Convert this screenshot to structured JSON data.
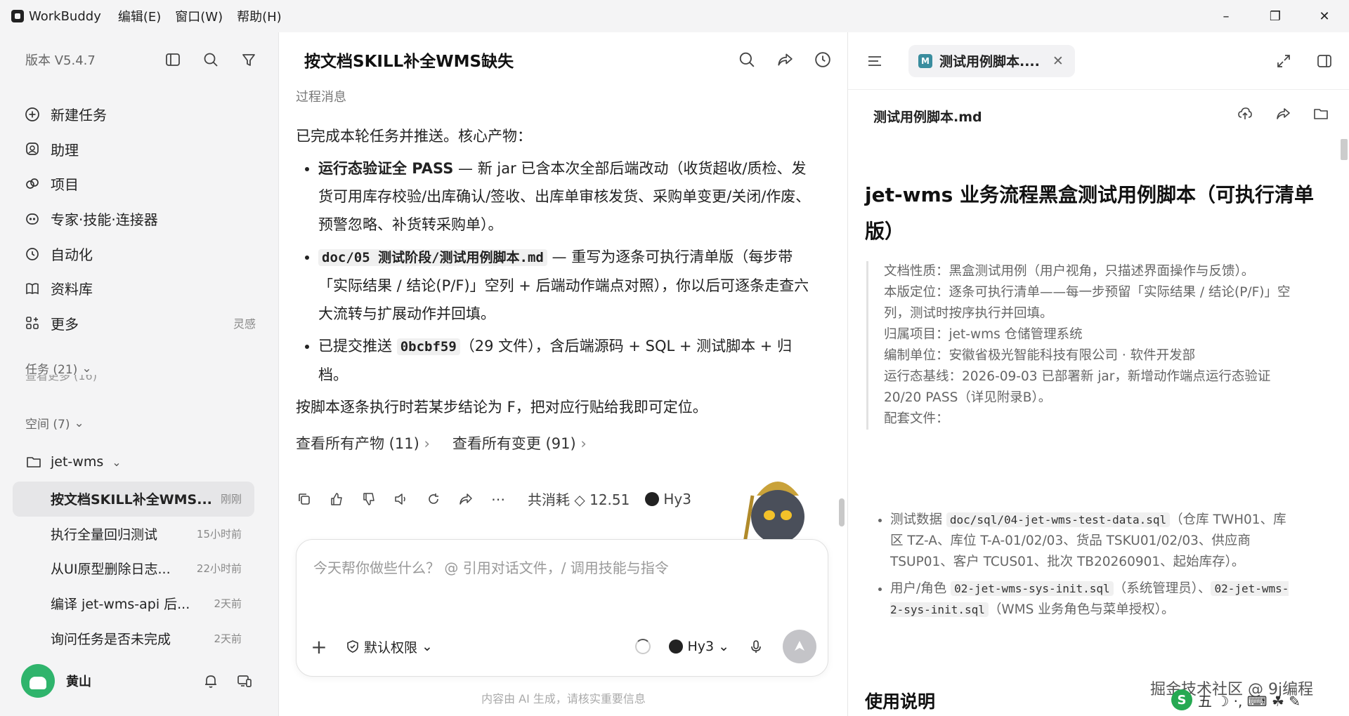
{
  "app": {
    "name": "WorkBuddy",
    "menu": [
      "编辑(E)",
      "窗口(W)",
      "帮助(H)"
    ]
  },
  "window": {
    "minimize": "–",
    "restore": "❐",
    "close": "✕"
  },
  "sidebar": {
    "version": "版本 V5.4.7",
    "nav": [
      {
        "label": "新建任务",
        "icon": "plus-circle-icon"
      },
      {
        "label": "助理",
        "icon": "assistant-icon"
      },
      {
        "label": "项目",
        "icon": "project-icon"
      },
      {
        "label": "专家·技能·连接器",
        "icon": "expert-icon"
      },
      {
        "label": "自动化",
        "icon": "clock-icon"
      },
      {
        "label": "资料库",
        "icon": "book-icon"
      },
      {
        "label": "更多",
        "icon": "grid-icon",
        "extra": "灵感"
      }
    ],
    "tasks_label": "任务 (21)",
    "tasks_peek": "查看更多 (16)",
    "space_label": "空间 (7)",
    "folder": "jet-wms",
    "tasks": [
      {
        "title": "按文档SKILL补全WMS...",
        "time": "刚刚",
        "active": true
      },
      {
        "title": "执行全量回归测试",
        "time": "15小时前"
      },
      {
        "title": "从UI原型删除日志...",
        "time": "22小时前"
      },
      {
        "title": "编译 jet-wms-api 后...",
        "time": "2天前"
      },
      {
        "title": "询问任务是否未完成",
        "time": "2天前"
      }
    ],
    "user": "黄山"
  },
  "main": {
    "title": "按文档SKILL补全WMS缺失",
    "process_label": "过程消息",
    "intro": "已完成本轮任务并推送。核心产物：",
    "bullet1": {
      "strong": "运行态验证全 PASS",
      "text": " — 新 jar 已含本次全部后端改动（收货超收/质检、发货可用库存校验/出库确认/签收、出库单审核发货、采购单变更/关闭/作废、预警忽略、补货转采购单）。"
    },
    "bullet2": {
      "code": "doc/05 测试阶段/测试用例脚本.md",
      "text": " — 重写为逐条可执行清单版（每步带「实际结果 / 结论(P/F)」空列 + 后端动作端点对照），你以后可逐条走查六大流转与扩展动作并回填。"
    },
    "bullet3": {
      "pre": "已提交推送 ",
      "code": "0bcbf59",
      "text": "（29 文件），含后端源码 + SQL + 测试脚本 + 归档。"
    },
    "outro": "按脚本逐条执行时若某步结论为 F，把对应行贴给我即可定位。",
    "link_artifacts": "查看所有产物 (11)",
    "link_changes": "查看所有变更 (91)",
    "cost": "共消耗 ◇ 12.51",
    "model": "Hy3",
    "input_placeholder": "今天帮你做些什么？ @ 引用对话文件，/ 调用技能与指令",
    "permission": "默认权限",
    "model_select": "Hy3",
    "disclaimer": "内容由 AI 生成，请核实重要信息"
  },
  "doc": {
    "tab_title": "测试用例脚本....",
    "tab_badge": "M",
    "file_name": "测试用例脚本.md",
    "h1": "jet-wms 业务流程黑盒测试用例脚本（可执行清单版）",
    "quote": [
      "文档性质：黑盒测试用例（用户视角，只描述界面操作与反馈）。",
      "本版定位：逐条可执行清单——每一步预留「实际结果 / 结论(P/F)」空列，测试时按序执行并回填。",
      "归属项目：jet-wms 仓储管理系统",
      "编制单位：安徽省极光智能科技有限公司 · 软件开发部",
      "运行态基线：2026-09-03 已部署新 jar，新增动作端点运行态验证 20/20 PASS（详见附录B）。",
      "配套文件："
    ],
    "list1": {
      "pre": "测试数据 ",
      "code": "doc/sql/04-jet-wms-test-data.sql",
      "text": "（仓库 TWH01、库区 TZ-A、库位 T-A-01/02/03、货品 TSKU01/02/03、供应商 TSUP01、客户 TCUS01、批次 TB20260901、起始库存）。"
    },
    "list2": {
      "pre": "用户/角色 ",
      "code1": "02-jet-wms-sys-init.sql",
      "mid": "（系统管理员）、",
      "code2": "02-jet-wms-2-sys-init.sql",
      "text": "（WMS 业务角色与菜单授权）。"
    },
    "h2": "使用说明",
    "watermark": "掘金技术社区 @ 9j编程"
  },
  "ime": {
    "logo": "S",
    "text": "五 ☽ ·, ⌨ ☘ ✎"
  }
}
